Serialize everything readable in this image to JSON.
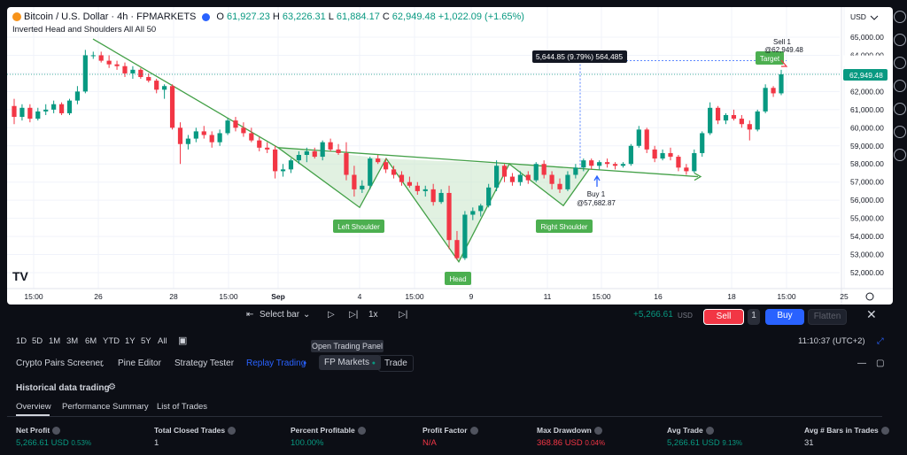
{
  "header": {
    "symbol": "Bitcoin / U.S. Dollar · 4h · FPMARKETS",
    "o_label": "O",
    "o": "61,927.23",
    "h_label": "H",
    "h": "63,226.31",
    "l_label": "L",
    "l": "61,884.17",
    "c_label": "C",
    "c": "62,949.48",
    "change": "+1,022.09 (+1.65%)",
    "indicator": "Inverted Head and Shoulders All All 50"
  },
  "axis": {
    "currency": "USD",
    "last_price": "62,949.48",
    "ticks": [
      "65,000.00",
      "64,000.00",
      "63,000.00",
      "62,000.00",
      "61,000.00",
      "60,000.00",
      "59,000.00",
      "58,000.00",
      "57,000.00",
      "56,000.00",
      "55,000.00",
      "54,000.00",
      "53,000.00",
      "52,000.00"
    ],
    "time_labels": [
      "15:00",
      "26",
      "28",
      "15:00",
      "Sep",
      "4",
      "15:00",
      "9",
      "11",
      "15:00",
      "16",
      "18",
      "15:00",
      "25"
    ]
  },
  "chart": {
    "left_shoulder": "Left Shoulder",
    "head": "Head",
    "right_shoulder": "Right Shoulder",
    "target": "Target",
    "buy_label": "Buy 1",
    "buy_price": "@57,682.87",
    "sell_label": "Sell 1",
    "sell_price": "@62,949.48",
    "measure": "5,644.85 (9.79%) 564,485",
    "watermark": "TV",
    "colors": {
      "up": "#089981",
      "down": "#f23645",
      "pattern": "#43a047",
      "fill": "#c8e6c9",
      "label_bg": "#4caf50"
    }
  },
  "replay": {
    "select_bar": "Select bar",
    "speed": "1x",
    "pnl": "+5,266.61",
    "pnl_unit": "USD",
    "sell": "Sell",
    "qty": "1",
    "buy": "Buy",
    "flatten": "Flatten"
  },
  "timeframes": [
    "1D",
    "5D",
    "1M",
    "3M",
    "6M",
    "YTD",
    "1Y",
    "5Y",
    "All"
  ],
  "clock": "11:10:37 (UTC+2)",
  "tooltip": "Open Trading Panel",
  "tabs": [
    "Crypto Pairs Screener",
    "Pine Editor",
    "Strategy Tester",
    "Replay Trading",
    "FP Markets",
    "Trade"
  ],
  "panel": {
    "title": "Historical data trading",
    "subtabs": [
      "Overview",
      "Performance Summary",
      "List of Trades"
    ],
    "metrics": [
      {
        "k": "Net Profit",
        "v": "5,266.61 USD",
        "s": "0.53%",
        "cls": "pos"
      },
      {
        "k": "Total Closed Trades",
        "v": "1",
        "s": "",
        "cls": ""
      },
      {
        "k": "Percent Profitable",
        "v": "100.00%",
        "s": "",
        "cls": "pos"
      },
      {
        "k": "Profit Factor",
        "v": "N/A",
        "s": "",
        "cls": "neg"
      },
      {
        "k": "Max Drawdown",
        "v": "368.86 USD",
        "s": "0.04%",
        "cls": "neg"
      },
      {
        "k": "Avg Trade",
        "v": "5,266.61 USD",
        "s": "9.13%",
        "cls": "pos"
      },
      {
        "k": "Avg # Bars in Trades",
        "v": "31",
        "s": "",
        "cls": ""
      }
    ]
  },
  "chart_data": {
    "type": "candlestick",
    "ylim": [
      51500,
      65800
    ],
    "candles": [
      [
        61200,
        61600,
        60200,
        60600
      ],
      [
        60600,
        61300,
        60400,
        61100
      ],
      [
        61100,
        61300,
        60300,
        60500
      ],
      [
        60500,
        61100,
        60400,
        60900
      ],
      [
        60900,
        61300,
        60700,
        61000
      ],
      [
        61000,
        61500,
        60800,
        61300
      ],
      [
        61300,
        61400,
        60700,
        60800
      ],
      [
        60800,
        61600,
        60700,
        61500
      ],
      [
        61500,
        62300,
        61300,
        62000
      ],
      [
        62000,
        64300,
        61900,
        64000
      ],
      [
        64000,
        64200,
        63800,
        64000
      ],
      [
        64000,
        64200,
        63600,
        63700
      ],
      [
        63700,
        64000,
        63300,
        63500
      ],
      [
        63500,
        63700,
        63200,
        63400
      ],
      [
        63400,
        63600,
        62800,
        63000
      ],
      [
        63000,
        63400,
        62700,
        63200
      ],
      [
        63200,
        63300,
        62700,
        62800
      ],
      [
        62800,
        63000,
        62500,
        62600
      ],
      [
        62600,
        62700,
        61900,
        62100
      ],
      [
        62100,
        62400,
        61600,
        62300
      ],
      [
        62300,
        62400,
        59900,
        60000
      ],
      [
        60000,
        60300,
        58000,
        59100
      ],
      [
        59100,
        59600,
        58800,
        59400
      ],
      [
        59400,
        60000,
        59200,
        59800
      ],
      [
        59800,
        60100,
        59400,
        59600
      ],
      [
        59600,
        59800,
        58900,
        59200
      ],
      [
        59200,
        59900,
        59000,
        59700
      ],
      [
        59700,
        60500,
        59600,
        60400
      ],
      [
        60400,
        60600,
        59800,
        60000
      ],
      [
        60000,
        60300,
        59500,
        59700
      ],
      [
        59700,
        60000,
        59200,
        59300
      ],
      [
        59300,
        59500,
        58700,
        58900
      ],
      [
        58900,
        59200,
        58600,
        58800
      ],
      [
        58800,
        59000,
        57200,
        57600
      ],
      [
        57600,
        58000,
        57300,
        57700
      ],
      [
        57700,
        58300,
        57500,
        58200
      ],
      [
        58200,
        58700,
        58000,
        58500
      ],
      [
        58500,
        58900,
        58100,
        58700
      ],
      [
        58700,
        58900,
        58300,
        58400
      ],
      [
        58400,
        59300,
        58200,
        59200
      ],
      [
        59200,
        59400,
        58700,
        58800
      ],
      [
        58800,
        59100,
        58500,
        58600
      ],
      [
        58600,
        59200,
        57100,
        57400
      ],
      [
        57400,
        57900,
        56200,
        56600
      ],
      [
        56600,
        57100,
        56400,
        56800
      ],
      [
        56800,
        58400,
        56600,
        58300
      ],
      [
        58300,
        58500,
        58000,
        58100
      ],
      [
        58100,
        58300,
        57500,
        57700
      ],
      [
        57700,
        57900,
        57200,
        57400
      ],
      [
        57400,
        57600,
        56800,
        57000
      ],
      [
        57000,
        57300,
        56700,
        56800
      ],
      [
        56800,
        57000,
        56300,
        56500
      ],
      [
        56500,
        56800,
        56200,
        56600
      ],
      [
        56600,
        56900,
        55700,
        55900
      ],
      [
        55900,
        56600,
        55800,
        56400
      ],
      [
        56400,
        56800,
        53300,
        53800
      ],
      [
        53800,
        54300,
        52700,
        52800
      ],
      [
        52800,
        55400,
        52700,
        55200
      ],
      [
        55200,
        55600,
        54900,
        55400
      ],
      [
        55400,
        55800,
        55100,
        55700
      ],
      [
        55700,
        56900,
        55600,
        56700
      ],
      [
        56700,
        58200,
        56500,
        57900
      ],
      [
        57900,
        58000,
        57000,
        57300
      ],
      [
        57300,
        57500,
        56800,
        57000
      ],
      [
        57000,
        57600,
        56800,
        57400
      ],
      [
        57400,
        57600,
        56900,
        57100
      ],
      [
        57100,
        58100,
        57000,
        58000
      ],
      [
        58000,
        58200,
        57200,
        57400
      ],
      [
        57400,
        57600,
        56600,
        56900
      ],
      [
        56900,
        57200,
        56400,
        56600
      ],
      [
        56600,
        57600,
        56500,
        57400
      ],
      [
        57400,
        58000,
        57200,
        57800
      ],
      [
        57800,
        58300,
        57600,
        58200
      ],
      [
        58200,
        58300,
        57700,
        57900
      ],
      [
        57900,
        58200,
        57700,
        58100
      ],
      [
        58100,
        58300,
        57800,
        58000
      ],
      [
        58000,
        58100,
        57700,
        57900
      ],
      [
        57900,
        58100,
        57800,
        58000
      ],
      [
        58000,
        59100,
        57900,
        59000
      ],
      [
        59000,
        60100,
        58900,
        59900
      ],
      [
        59900,
        60000,
        58600,
        58800
      ],
      [
        58800,
        59000,
        58100,
        58300
      ],
      [
        58300,
        58800,
        58200,
        58600
      ],
      [
        58600,
        58900,
        58200,
        58400
      ],
      [
        58400,
        58500,
        57600,
        57800
      ],
      [
        57800,
        58000,
        57400,
        57600
      ],
      [
        57600,
        58800,
        57500,
        58600
      ],
      [
        58600,
        59800,
        58400,
        59700
      ],
      [
        59700,
        61400,
        59600,
        61100
      ],
      [
        61100,
        61200,
        60200,
        60400
      ],
      [
        60400,
        60800,
        60200,
        60700
      ],
      [
        60700,
        61000,
        60400,
        60500
      ],
      [
        60500,
        60700,
        60000,
        60200
      ],
      [
        60200,
        60400,
        59300,
        59900
      ],
      [
        59900,
        61000,
        59800,
        60900
      ],
      [
        60900,
        62400,
        60800,
        62200
      ],
      [
        62200,
        62300,
        61700,
        61900
      ],
      [
        61900,
        63200,
        61800,
        62950
      ]
    ]
  }
}
